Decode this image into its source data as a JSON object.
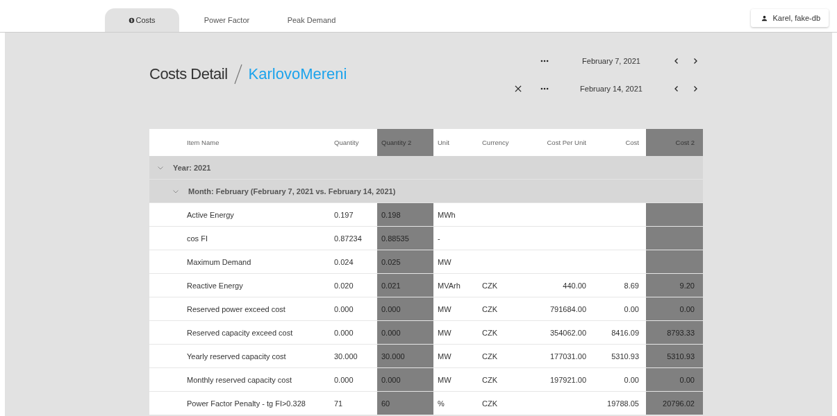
{
  "tabs": [
    {
      "label": "Costs",
      "selected": true
    },
    {
      "label": "Power Factor",
      "selected": false
    },
    {
      "label": "Peak Demand",
      "selected": false
    }
  ],
  "user": {
    "label": "Karel, fake-db"
  },
  "title": {
    "text": "Costs Detail",
    "site": "KarlovoMereni"
  },
  "dates": [
    {
      "date": "February 7, 2021",
      "removable": false
    },
    {
      "date": "February 14, 2021",
      "removable": true
    }
  ],
  "table": {
    "columns": [
      {
        "label": "Item Name",
        "kind": "text",
        "highlighted": false
      },
      {
        "label": "Quantity",
        "kind": "text",
        "highlighted": false
      },
      {
        "label": "Quantity 2",
        "kind": "text",
        "highlighted": true
      },
      {
        "label": "Unit",
        "kind": "text",
        "highlighted": false
      },
      {
        "label": "Currency",
        "kind": "text",
        "highlighted": false
      },
      {
        "label": "Cost Per Unit",
        "kind": "number",
        "highlighted": false
      },
      {
        "label": "Cost",
        "kind": "number",
        "highlighted": false
      },
      {
        "label": "Cost 2",
        "kind": "number",
        "highlighted": true
      }
    ],
    "groups": [
      {
        "label": "Year: 2021",
        "expanded": true,
        "children": [
          {
            "label": "Month: February (February 7, 2021 vs. February 14, 2021)",
            "expanded": true,
            "rows": [
              [
                "Active Energy",
                "0.197",
                "0.198",
                "MWh",
                null,
                null,
                null,
                null
              ],
              [
                "cos FI",
                "0.87234",
                "0.88535",
                "-",
                null,
                null,
                null,
                null
              ],
              [
                "Maximum Demand",
                "0.024",
                "0.025",
                "MW",
                null,
                null,
                null,
                null
              ],
              [
                "Reactive Energy",
                "0.020",
                "0.021",
                "MVArh",
                "CZK",
                "440.00",
                "8.69",
                "9.20"
              ],
              [
                "Reserved power exceed cost",
                "0.000",
                "0.000",
                "MW",
                "CZK",
                "791684.00",
                "0.00",
                "0.00"
              ],
              [
                "Reserved capacity exceed cost",
                "0.000",
                "0.000",
                "MW",
                "CZK",
                "354062.00",
                "8416.09",
                "8793.33"
              ],
              [
                "Yearly reserved capacity cost",
                "30.000",
                "30.000",
                "MW",
                "CZK",
                "177031.00",
                "5310.93",
                "5310.93"
              ],
              [
                "Monthly reserved capacity cost",
                "0.000",
                "0.000",
                "MW",
                "CZK",
                "197921.00",
                "0.00",
                "0.00"
              ],
              [
                "Power Factor Penalty - tg FI>0.328",
                "71",
                "60",
                "%",
                "CZK",
                null,
                "19788.05",
                "20796.02"
              ]
            ]
          }
        ]
      }
    ]
  }
}
